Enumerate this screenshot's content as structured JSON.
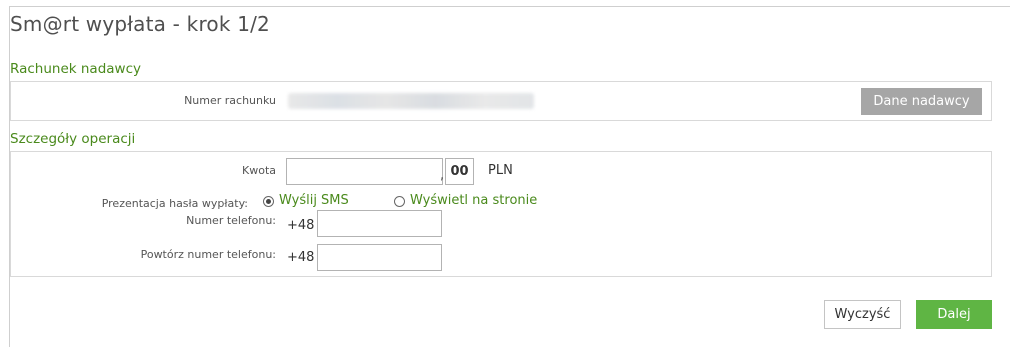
{
  "page": {
    "title": "Sm@rt wypłata - krok 1/2"
  },
  "sender_section": {
    "title": "Rachunek nadawcy",
    "account_label": "Numer rachunku",
    "sender_button": "Dane nadawcy"
  },
  "details_section": {
    "title": "Szczegóły operacji",
    "amount_label": "Kwota",
    "amount_value": "",
    "amount_separator": ",",
    "amount_cents": "00",
    "currency": "PLN",
    "password_label": "Prezentacja hasła wypłaty:",
    "options": [
      {
        "label": "Wyślij SMS",
        "selected": true
      },
      {
        "label": "Wyświetl na stronie",
        "selected": false
      }
    ],
    "phone_label": "Numer telefonu:",
    "phone_repeat_label": "Powtórz numer telefonu:",
    "phone_prefix": "+48",
    "phone_value": "",
    "phone_repeat_value": ""
  },
  "actions": {
    "clear": "Wyczyść",
    "next": "Dalej"
  },
  "colors": {
    "accent_green": "#5fb544",
    "section_green": "#4a8a1c",
    "disabled_gray": "#a6a6a6"
  }
}
